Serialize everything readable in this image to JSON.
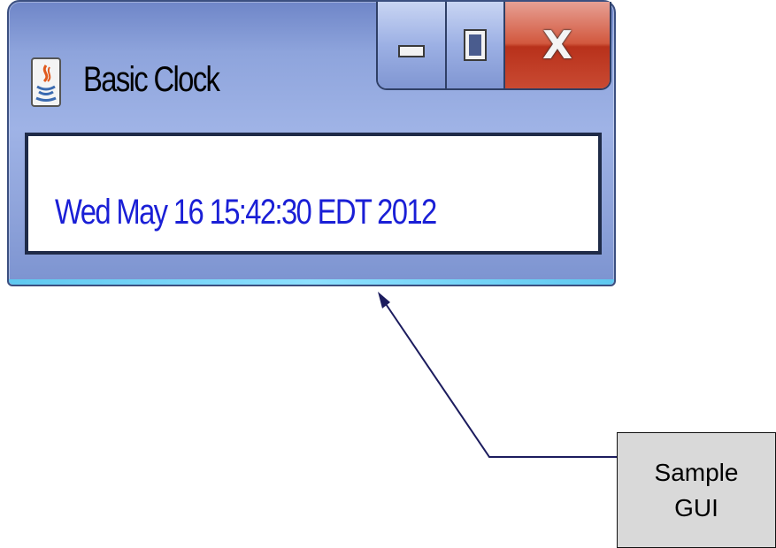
{
  "window": {
    "title": "Basic Clock",
    "clock_text": "Wed May 16 15:42:30 EDT 2012",
    "controls": {
      "minimize_icon": "minimize-icon",
      "maximize_icon": "maximize-icon",
      "close_label": "X"
    }
  },
  "annotation": {
    "line1": "Sample",
    "line2": "GUI"
  },
  "colors": {
    "clock_text": "#1a1fd6",
    "frame": "#8ea4dc",
    "close_button": "#c94a32",
    "callout_fill": "#d9d9d9",
    "arrow": "#1c1c5e"
  }
}
